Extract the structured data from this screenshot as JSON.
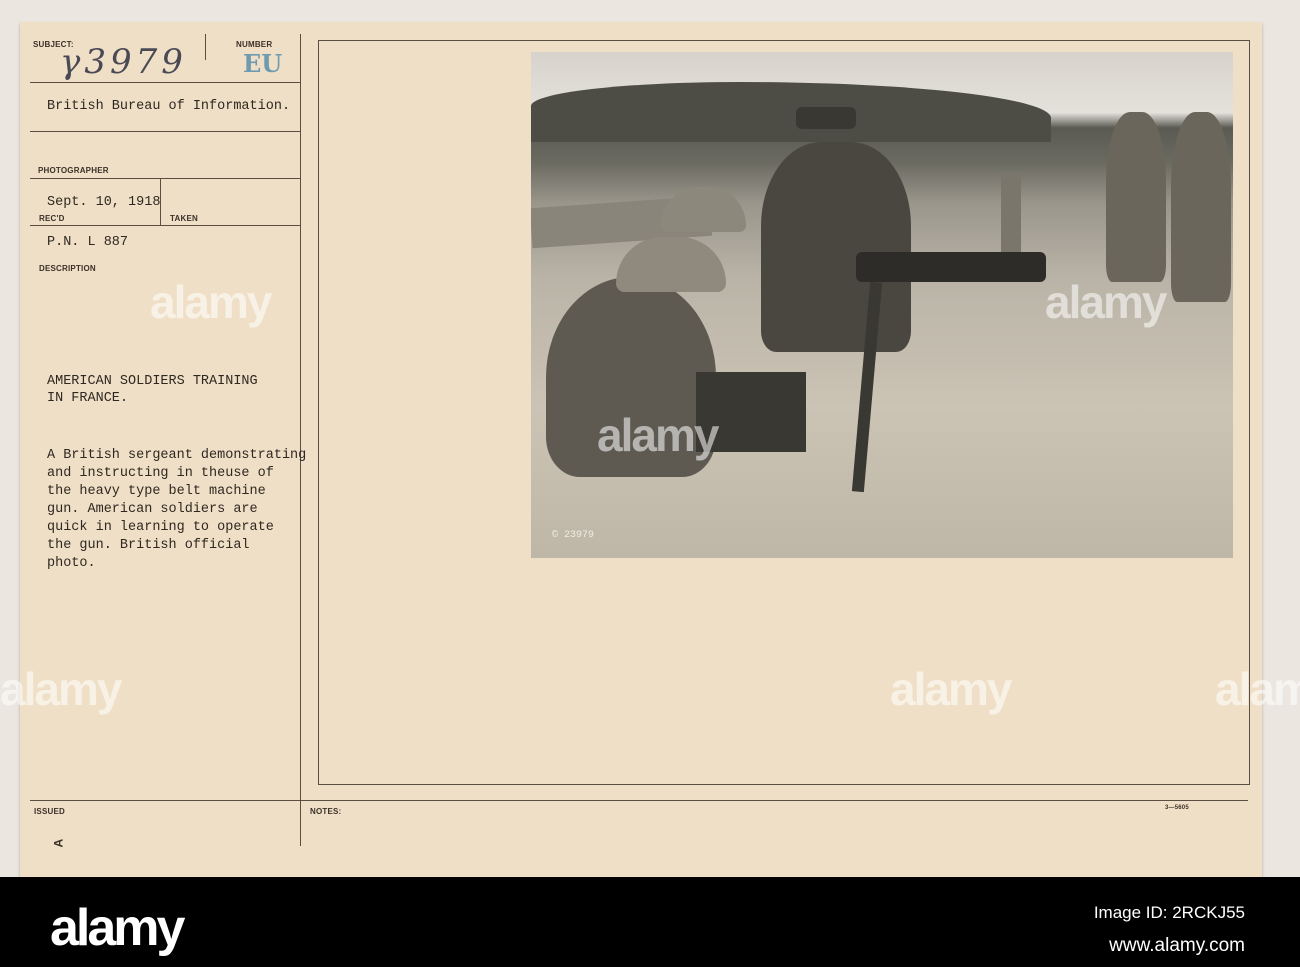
{
  "card": {
    "subject_label": "SUBJECT:",
    "subject_number": "γ3979",
    "number_label": "NUMBER",
    "number_stamp": "EU",
    "source": "British Bureau of Information.",
    "photographer_label": "PHOTOGRAPHER",
    "date": "Sept. 10, 1918",
    "recd_label": "REC'D",
    "taken_label": "TAKEN",
    "pn": "P.N. L 887",
    "description_label": "DESCRIPTION",
    "title_lines": [
      "AMERICAN SOLDIERS TRAINING",
      "IN FRANCE."
    ],
    "description_lines": [
      "A British sergeant demonstrating",
      "and instructing in theuse of",
      "the heavy type belt machine",
      "gun. American soldiers are",
      "quick in learning to operate",
      "the gun. British official",
      "photo."
    ],
    "issued_label": "ISSUED",
    "issued_mark": "A",
    "notes_label": "NOTES:",
    "form_number": "3—5605",
    "photo_caption": "© 23979"
  },
  "watermark": "alamy",
  "footer": {
    "logo": "alamy",
    "image_id": "Image ID: 2RCKJ55",
    "url": "www.alamy.com"
  }
}
